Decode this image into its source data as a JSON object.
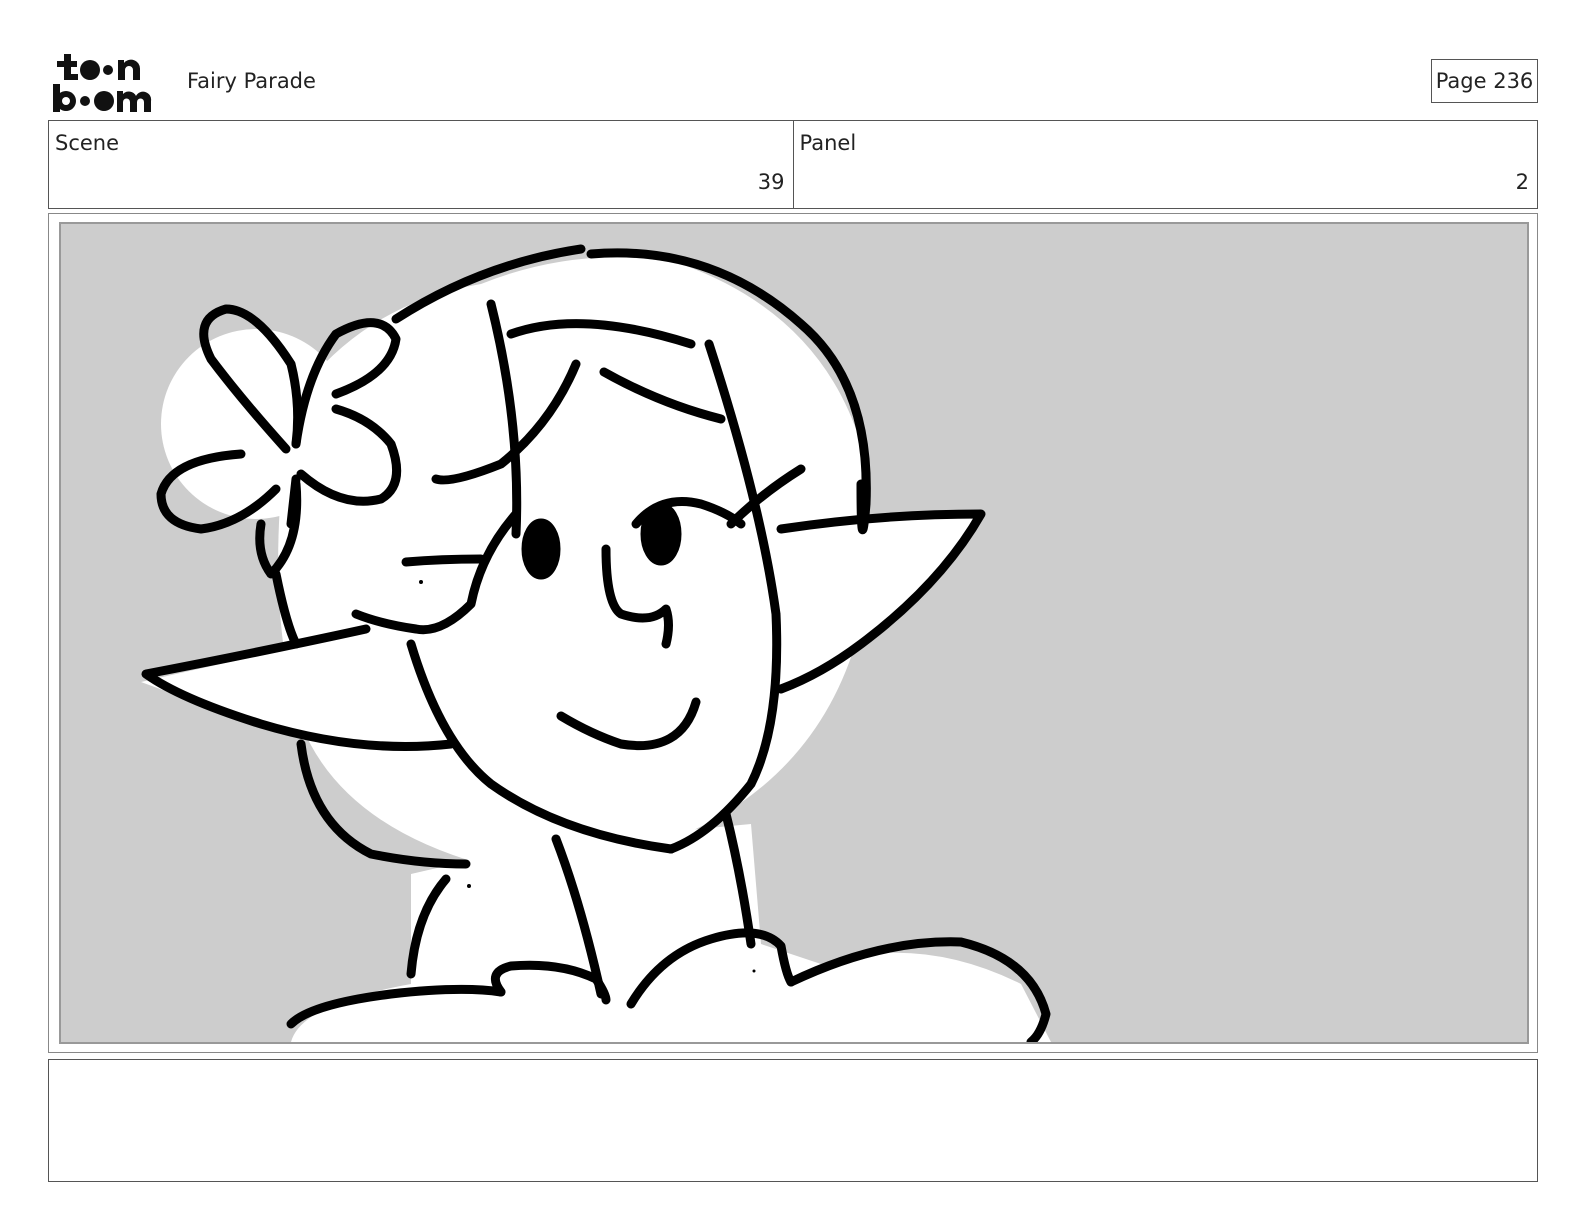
{
  "header": {
    "logo_text_top": "toon",
    "logo_text_bottom": "boom",
    "project_title": "Fairy Parade",
    "page_label": "Page 236"
  },
  "info": {
    "scene_label": "Scene",
    "scene_value": "39",
    "panel_label": "Panel",
    "panel_value": "2"
  },
  "panel": {
    "background_color": "#cdcdcd",
    "line_color": "#000000"
  },
  "notes": {
    "text": ""
  }
}
